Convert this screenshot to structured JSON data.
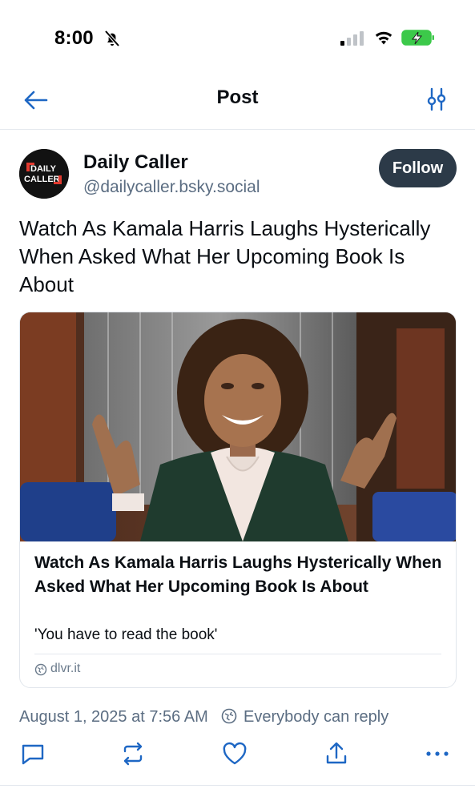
{
  "status_bar": {
    "time": "8:00",
    "icons": [
      "bell-slash-icon",
      "cellular-signal-icon",
      "wifi-icon",
      "battery-charging-icon"
    ]
  },
  "header": {
    "title": "Post",
    "left_icon": "arrow-left-icon",
    "right_icon": "sliders-icon"
  },
  "author": {
    "display_name": "Daily Caller",
    "handle": "@dailycaller.bsky.social",
    "avatar_text": [
      "DAILY",
      "CALLER"
    ],
    "follow_label": "Follow"
  },
  "post": {
    "text": "Watch As Kamala Harris Laughs Hysterically When Asked What Her Upcoming Book Is About",
    "date": "August 1, 2025 at 7:56 AM",
    "reply_setting": "Everybody can reply"
  },
  "link_card": {
    "title": "Watch As Kamala Harris Laughs Hysterically When Asked What Her Upcoming Book Is About",
    "description": "'You have to read the book'",
    "domain": "dlvr.it"
  },
  "actions": [
    "reply-icon",
    "repost-icon",
    "like-icon",
    "share-icon",
    "more-icon"
  ],
  "colors": {
    "follow_bg": "#2c3a48",
    "accent": "#1e67c4",
    "muted_text": "#5b6d82",
    "divider": "#e4e8ee",
    "battery_green": "#3cc94a"
  }
}
